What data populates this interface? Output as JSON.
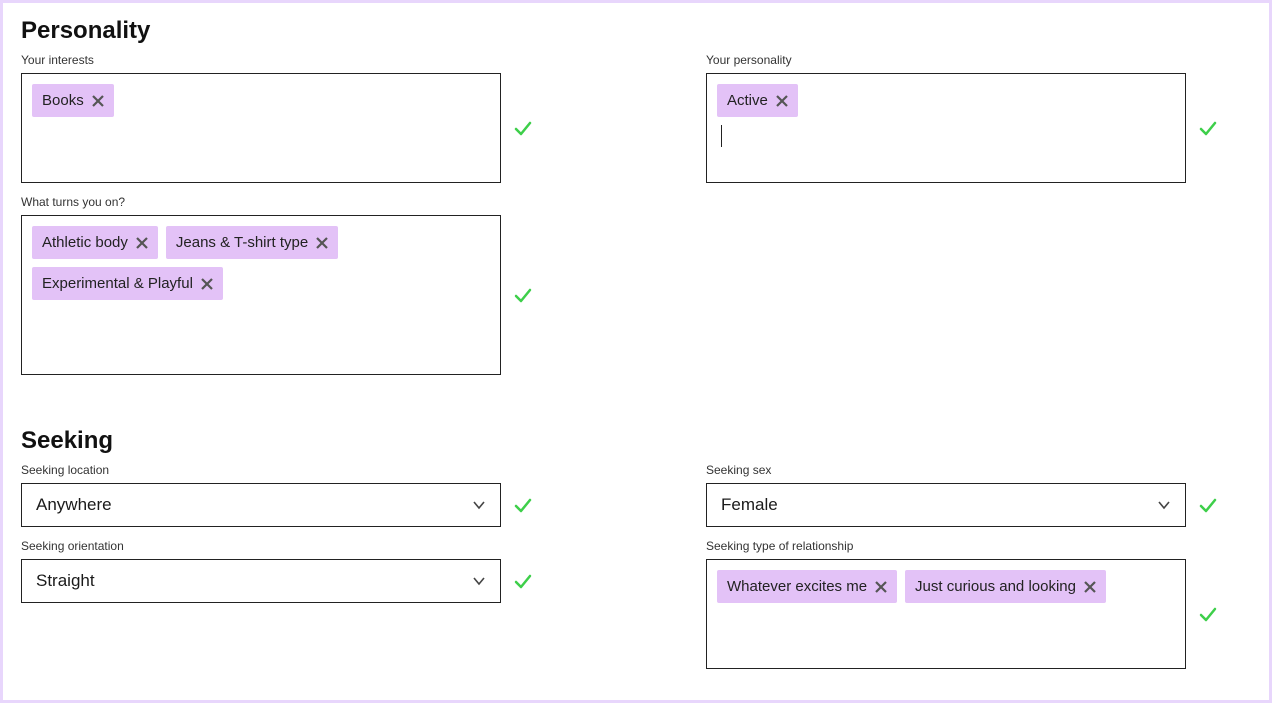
{
  "sections": {
    "personality": {
      "heading": "Personality",
      "interests": {
        "label": "Your interests",
        "tags": [
          "Books"
        ]
      },
      "personality_traits": {
        "label": "Your personality",
        "tags": [
          "Active"
        ]
      },
      "turns_on": {
        "label": "What turns you on?",
        "tags": [
          "Athletic body",
          "Jeans & T-shirt type",
          "Experimental & Playful"
        ]
      }
    },
    "seeking": {
      "heading": "Seeking",
      "location": {
        "label": "Seeking location",
        "value": "Anywhere"
      },
      "sex": {
        "label": "Seeking sex",
        "value": "Female"
      },
      "orientation": {
        "label": "Seeking orientation",
        "value": "Straight"
      },
      "relationship": {
        "label": "Seeking type of relationship",
        "tags": [
          "Whatever excites me",
          "Just curious and looking"
        ]
      }
    }
  },
  "colors": {
    "tag_bg": "#e3c2f7",
    "check": "#3ecf4a",
    "page_border": "#e8d6fc"
  }
}
